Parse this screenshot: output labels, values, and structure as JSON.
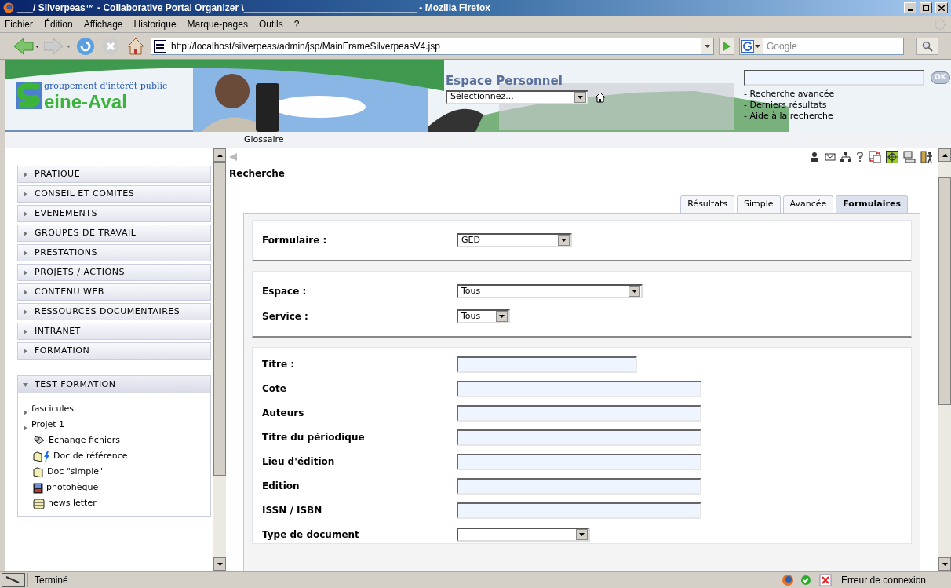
{
  "window": {
    "title": "___/ Silverpeas™ - Collaborative Portal Organizer \\_________________________________ - Mozilla Firefox"
  },
  "menu": [
    "Fichier",
    "Édition",
    "Affichage",
    "Historique",
    "Marque-pages",
    "Outils",
    "?"
  ],
  "toolbar": {
    "url": "http://localhost/silverpeas/admin/jsp/MainFrameSilverpeasV4.jsp",
    "search_placeholder": "Google"
  },
  "banner": {
    "logo_line1": "groupement d'intérêt public",
    "logo_line2": "eine-Aval",
    "space_title": "Espace Personnel",
    "space_select": "Sélectionnez...",
    "search_button": "OK",
    "links": [
      "- Recherche avancée",
      "- Derniers résultats",
      "- Aide à la recherche"
    ],
    "nav_tab": "Glossaire"
  },
  "sidebar": {
    "items": [
      {
        "label": "PRATIQUE",
        "expanded": false
      },
      {
        "label": "CONSEIL ET COMITES",
        "expanded": false
      },
      {
        "label": "EVENEMENTS",
        "expanded": false
      },
      {
        "label": "GROUPES DE TRAVAIL",
        "expanded": false
      },
      {
        "label": "PRESTATIONS",
        "expanded": false
      },
      {
        "label": "PROJETS / ACTIONS",
        "expanded": false
      },
      {
        "label": "CONTENU WEB",
        "expanded": false
      },
      {
        "label": "RESSOURCES DOCUMENTAIRES",
        "expanded": false
      },
      {
        "label": "INTRANET",
        "expanded": false
      },
      {
        "label": "FORMATION",
        "expanded": false
      }
    ],
    "panel": {
      "label": "TEST FORMATION",
      "expanded": true,
      "children": [
        {
          "label": "fascicules",
          "kind": "topic"
        },
        {
          "label": "Projet 1",
          "kind": "topic"
        },
        {
          "label": "Echange fichiers",
          "kind": "exchange"
        },
        {
          "label": "Doc de référence",
          "kind": "docref"
        },
        {
          "label": "Doc \"simple\"",
          "kind": "doc"
        },
        {
          "label": "photohèque",
          "kind": "gallery"
        },
        {
          "label": "news letter",
          "kind": "newsletter"
        }
      ]
    }
  },
  "content": {
    "title": "Recherche",
    "tabs": [
      {
        "label": "Résultats",
        "selected": false
      },
      {
        "label": "Simple",
        "selected": false
      },
      {
        "label": "Avancée",
        "selected": false
      },
      {
        "label": "Formulaires",
        "selected": true
      }
    ],
    "sections": [
      [
        {
          "label": "Formulaire :",
          "kind": "select",
          "value": "GED"
        }
      ],
      [
        {
          "label": "Espace :",
          "kind": "select",
          "value": "Tous"
        },
        {
          "label": "Service :",
          "kind": "select",
          "value": "Tous"
        }
      ],
      [
        {
          "label": "Titre :",
          "kind": "text"
        },
        {
          "label": "Cote",
          "kind": "text"
        },
        {
          "label": "Auteurs",
          "kind": "text"
        },
        {
          "label": "Titre du périodique",
          "kind": "text"
        },
        {
          "label": "Lieu d'édition",
          "kind": "text"
        },
        {
          "label": "Edition",
          "kind": "text"
        },
        {
          "label": "ISSN / ISBN",
          "kind": "text"
        },
        {
          "label": "Type de document",
          "kind": "select"
        }
      ]
    ]
  },
  "status_bar": {
    "text": "Terminé",
    "connection": "Erreur de connexion"
  }
}
